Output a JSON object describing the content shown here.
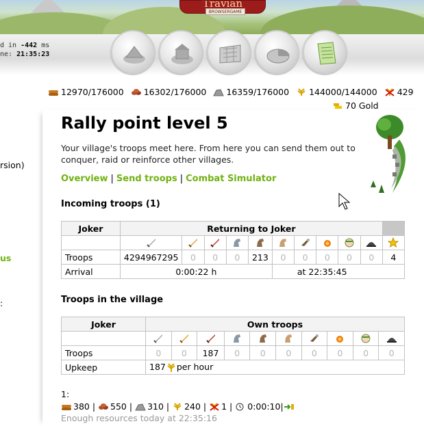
{
  "header": {
    "logo_text": "Travian",
    "logo_sub": "BROWSERGAME",
    "latency_line1_prefix": "d in ",
    "latency_value": "-442",
    "latency_unit": " ms",
    "server_time_prefix": "ne: ",
    "server_time": "21:35:23",
    "nav_icons": [
      "village-overview-icon",
      "village-center-icon",
      "map-icon",
      "statistics-icon",
      "reports-icon"
    ]
  },
  "left_fragments": {
    "frag1": "rsion)",
    "frag2": "us",
    "frag3": ":"
  },
  "resources": {
    "wood": "12970/176000",
    "clay": "16302/176000",
    "iron": "16359/176000",
    "crop": "144000/144000",
    "crop_consumption": "429",
    "gold": "70 Gold"
  },
  "page": {
    "title": "Rally point level 5",
    "intro": "Your village's troops meet here. From here you can send them out to conquer, raid or reinforce other villages.",
    "links": [
      "Overview",
      "Send troops",
      "Combat Simulator"
    ],
    "link_sep": "|"
  },
  "incoming": {
    "title": "Incoming troops (1)",
    "village": "Joker",
    "heading": "Returning to Joker",
    "row_label": "Troops",
    "values": [
      "4294967295",
      "0",
      "0",
      "0",
      "213",
      "0",
      "0",
      "0",
      "0",
      "0",
      "4"
    ],
    "arrival_label": "Arrival",
    "arrival_duration": "0:00:22 h",
    "arrival_at": "at 22:35:45"
  },
  "in_village": {
    "title": "Troops in the village",
    "village": "Joker",
    "heading": "Own troops",
    "row_label": "Troops",
    "values": [
      "0",
      "0",
      "187",
      "0",
      "0",
      "0",
      "0",
      "0",
      "0",
      "0"
    ],
    "upkeep_label": "Upkeep",
    "upkeep_value": "187",
    "upkeep_suffix": "per hour"
  },
  "send_cost": {
    "label": "1:",
    "wood": "380",
    "clay": "550",
    "iron": "310",
    "crop": "240",
    "crop_consumption": "1",
    "time": "0:00:10",
    "enough": "Enough resources today at 22:35:16"
  },
  "colors": {
    "link_green": "#71b211",
    "zero_grey": "#b6b6b6"
  }
}
